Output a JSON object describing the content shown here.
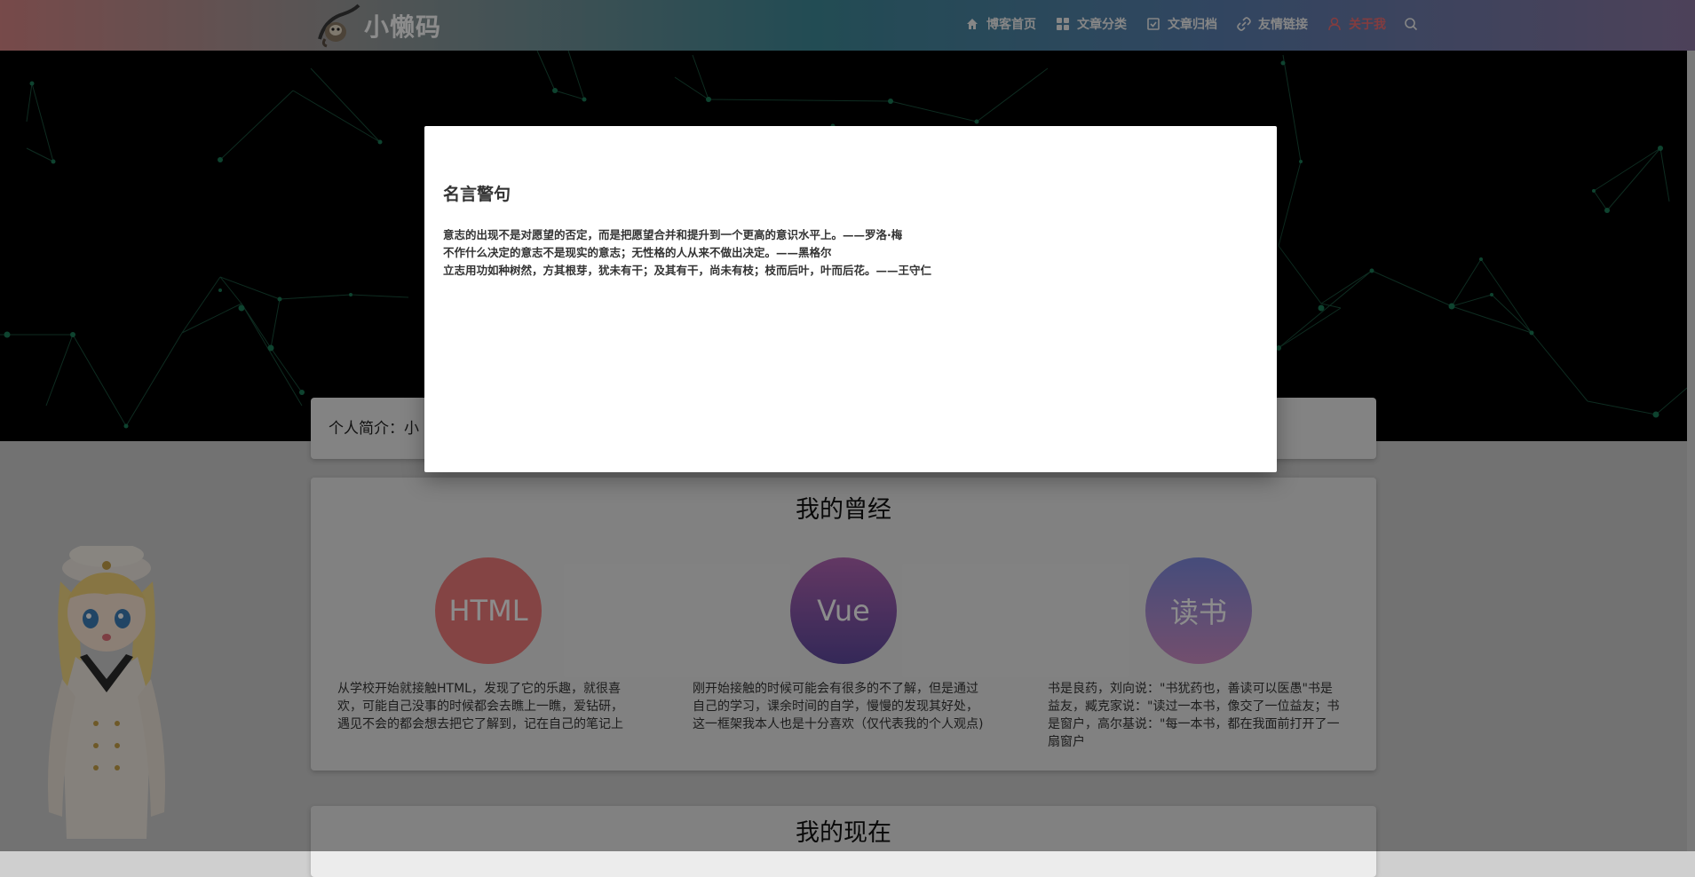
{
  "site": {
    "logo_text": "小懒码",
    "logo_icon": "sloth-logo-icon"
  },
  "nav": {
    "items": [
      {
        "label": "博客首页",
        "icon": "home-icon"
      },
      {
        "label": "文章分类",
        "icon": "grid-icon"
      },
      {
        "label": "文章归档",
        "icon": "archive-icon"
      },
      {
        "label": "友情链接",
        "icon": "link-icon"
      },
      {
        "label": "关于我",
        "icon": "user-icon",
        "active": true
      }
    ],
    "search_icon": "search-icon",
    "active_color": "#ee6e73"
  },
  "intro": {
    "text": "个人简介：小"
  },
  "past": {
    "title": "我的曾经",
    "skills": [
      {
        "label": "HTML",
        "color": "#f07c7c",
        "desc": "从学校开始就接触HTML，发现了它的乐趣，就很喜欢，可能自己没事的时候都会去瞧上一瞧，爱钻研，遇见不会的都会想去把它了解到，记在自己的笔记上"
      },
      {
        "label": "Vue",
        "color": "#8b5aa8",
        "desc": "刚开始接触的时候可能会有很多的不了解，但是通过自己的学习，课余时间的自学，慢慢的发现其好处，这一框架我本人也是十分喜欢（仅代表我的个人观点)"
      },
      {
        "label": "读书",
        "color": "#9a8fd0",
        "desc": "书是良药，刘向说：\"书犹药也，善读可以医愚\"书是益友，臧克家说：\"读过一本书，像交了一位益友；书是窗户，高尔基说：\"每一本书，都在我面前打开了一扇窗户"
      }
    ]
  },
  "now": {
    "title": "我的现在"
  },
  "modal": {
    "title": "名言警句",
    "quotes": [
      "意志的出现不是对愿望的否定，而是把愿望合并和提升到一个更高的意识水平上。——罗洛·梅",
      "不作什么决定的意志不是现实的意志；无性格的人从来不做出决定。——黑格尔",
      "立志用功如种树然，方其根芽，犹未有干；及其有干，尚未有枝；枝而后叶，叶而后花。——王守仁"
    ]
  }
}
